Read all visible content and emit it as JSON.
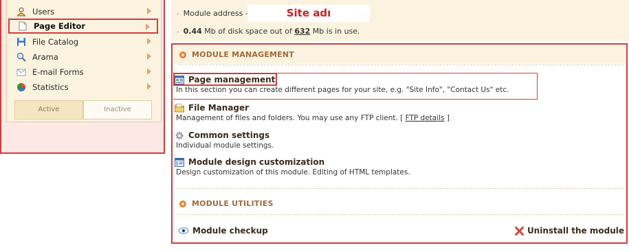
{
  "sidebar": {
    "items": [
      {
        "label": "Users",
        "icon": "user-icon"
      },
      {
        "label": "Page Editor",
        "icon": "page-icon"
      },
      {
        "label": "File Catalog",
        "icon": "floppy-disk-icon"
      },
      {
        "label": "Arama",
        "icon": "magnifier-icon"
      },
      {
        "label": "E-mail Forms",
        "icon": "envelope-icon"
      },
      {
        "label": "Statistics",
        "icon": "pie-chart-icon"
      }
    ],
    "tabs": {
      "active": "Active",
      "inactive": "Inactive"
    }
  },
  "header": {
    "address_prefix": "Module address -",
    "site_name": "Site adı",
    "disk_used": "0.44",
    "disk_text_1": " Mb of disk space out of ",
    "disk_total": "632",
    "disk_text_2": " Mb is in use."
  },
  "management": {
    "title": "MODULE MANAGEMENT",
    "page_management": {
      "title": "Page management",
      "desc": "In this section you can create different pages for your site, e.g. \"Site Info\", \"Contact Us\" etc."
    },
    "file_manager": {
      "title": "File Manager",
      "desc_prefix": "Management of files and folders. You may use any FTP client. [ ",
      "ftp_link": "FTP details",
      "desc_suffix": " ]"
    },
    "common_settings": {
      "title": "Common settings",
      "desc": "Individual module settings."
    },
    "design": {
      "title": "Module design customization",
      "desc": "Design customization of this module. Editing of HTML templates."
    }
  },
  "utilities": {
    "title": "MODULE UTILITIES",
    "checkup": "Module checkup",
    "uninstall": "Uninstall the module"
  },
  "colors": {
    "accent_red": "#d63a3a",
    "panel_bg": "#fbf3df",
    "section_orange": "#a5693c",
    "site_name_red": "#d21d1d"
  }
}
